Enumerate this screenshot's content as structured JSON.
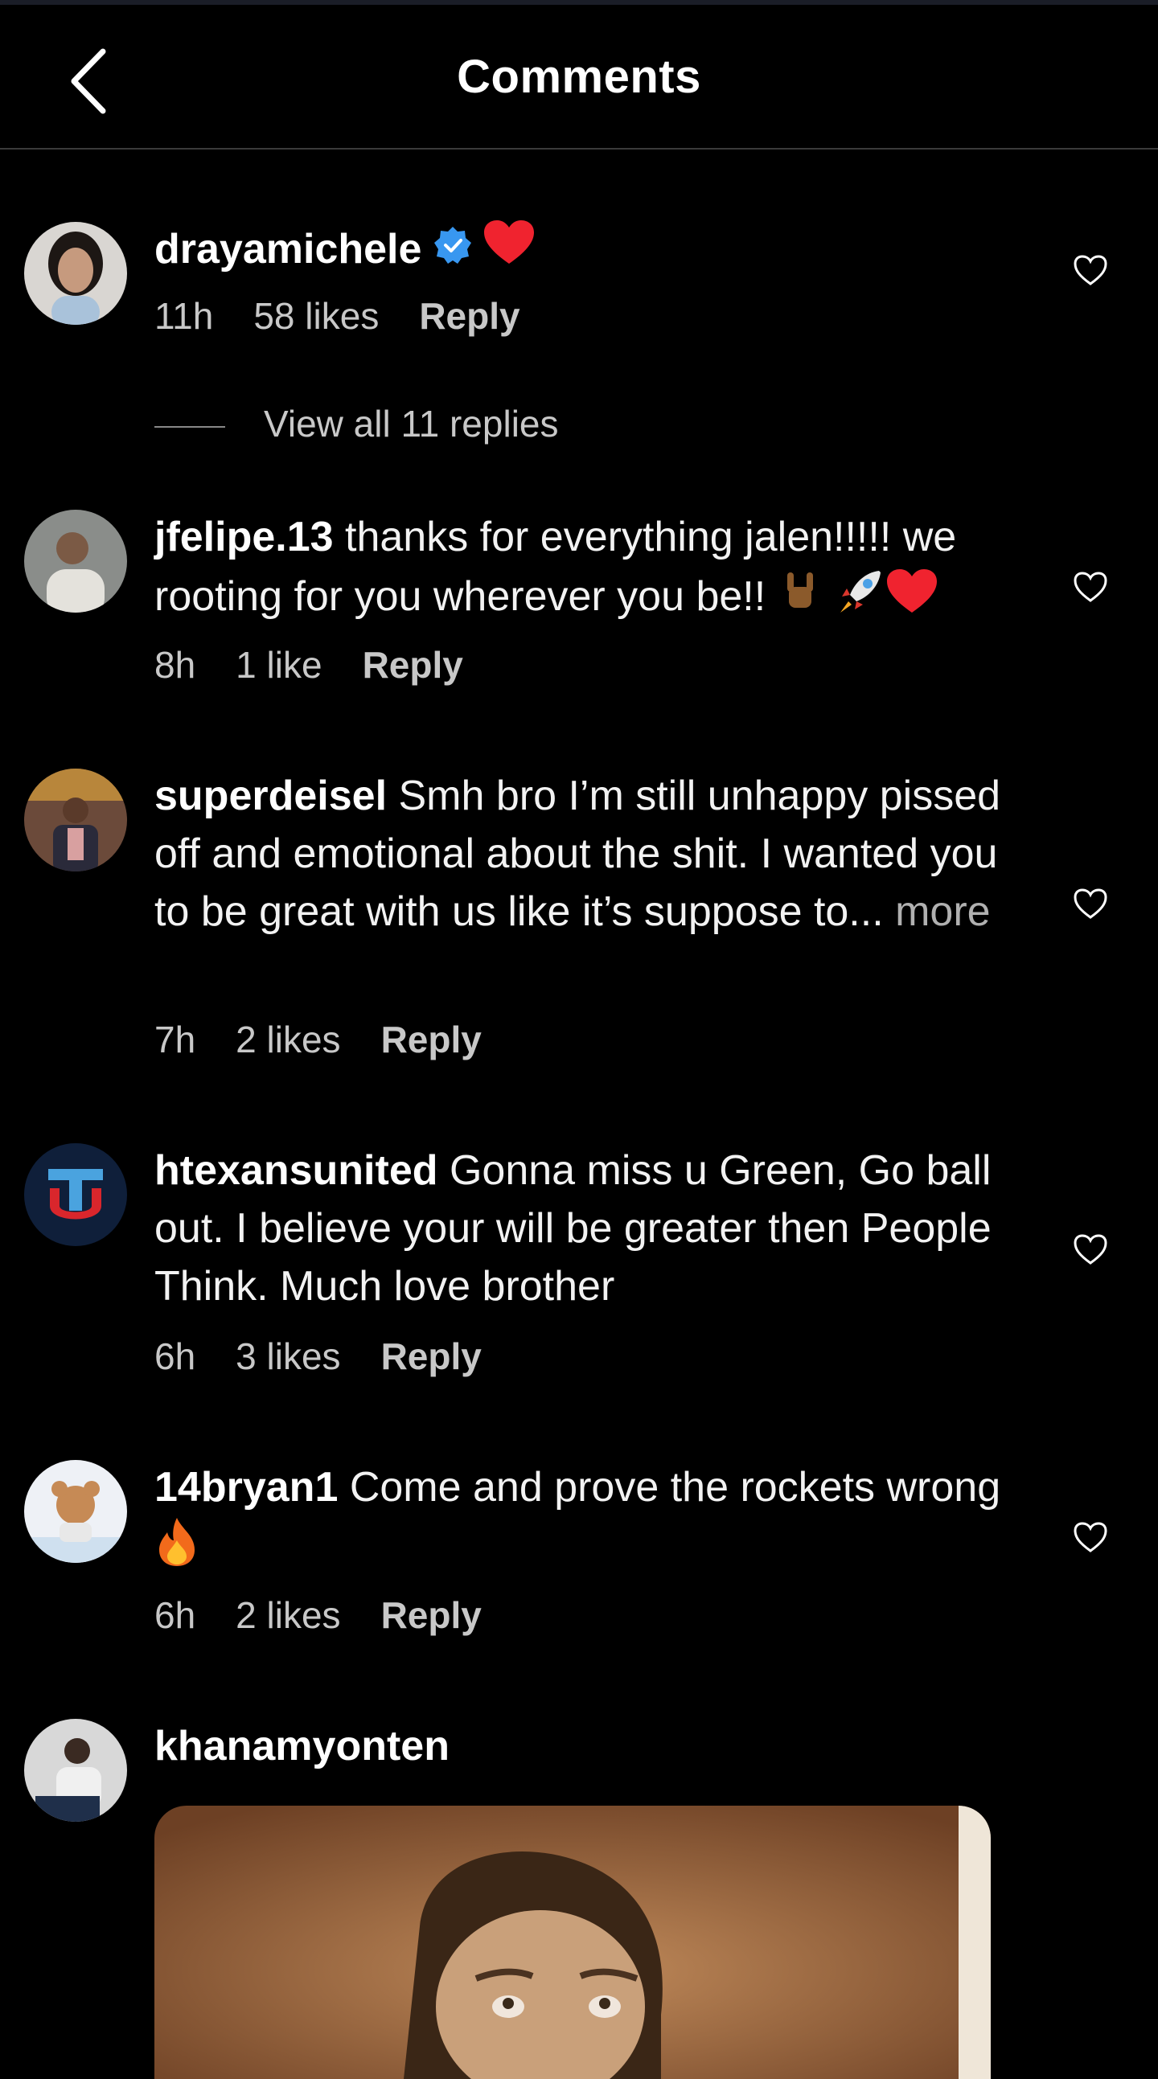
{
  "header": {
    "title": "Comments"
  },
  "reply_label": "Reply",
  "comments": [
    {
      "username": "drayamichele",
      "text": "",
      "time": "11h",
      "likes": "58 likes",
      "view_replies": "View all 11 replies"
    },
    {
      "username": "jfelipe.13",
      "text": "thanks for everything jalen!!!!! we rooting for you wherever you be!!",
      "time": "8h",
      "likes": "1 like"
    },
    {
      "username": "superdeisel",
      "text": "Smh bro I’m still unhappy pissed off and emotional about the shit. I wanted you to be great with us like it’s suppose to...",
      "more": "more",
      "time": "7h",
      "likes": "2 likes"
    },
    {
      "username": "htexansunited",
      "text": "Gonna miss u Green, Go ball out. I believe your will be greater then People Think. Much love brother",
      "time": "6h",
      "likes": "3 likes"
    },
    {
      "username": "14bryan1",
      "text": "Come and prove the rockets wrong",
      "time": "6h",
      "likes": "2 likes"
    },
    {
      "username": "khanamyonten",
      "text": ""
    }
  ]
}
